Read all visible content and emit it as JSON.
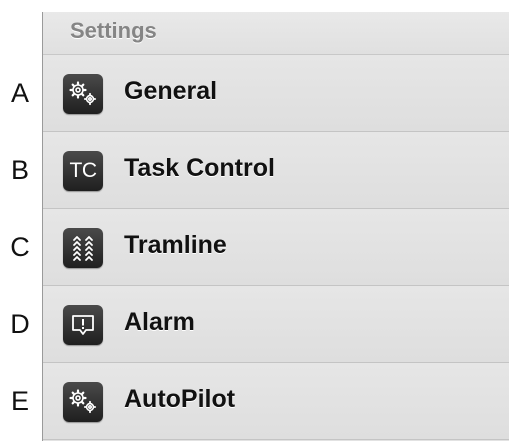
{
  "letters": [
    "A",
    "B",
    "C",
    "D",
    "E"
  ],
  "panel": {
    "title": "Settings",
    "items": [
      {
        "label": "General",
        "icon": "gears-icon"
      },
      {
        "label": "Task Control",
        "icon": "tc-icon",
        "icon_text": "TC"
      },
      {
        "label": "Tramline",
        "icon": "tramline-icon"
      },
      {
        "label": "Alarm",
        "icon": "alarm-icon"
      },
      {
        "label": "AutoPilot",
        "icon": "gears-icon"
      }
    ]
  },
  "colors": {
    "panel_bg": "#e2e2e2",
    "icon_bg": "#2a2a2a",
    "title_text": "#858585",
    "label_text": "#111111"
  }
}
